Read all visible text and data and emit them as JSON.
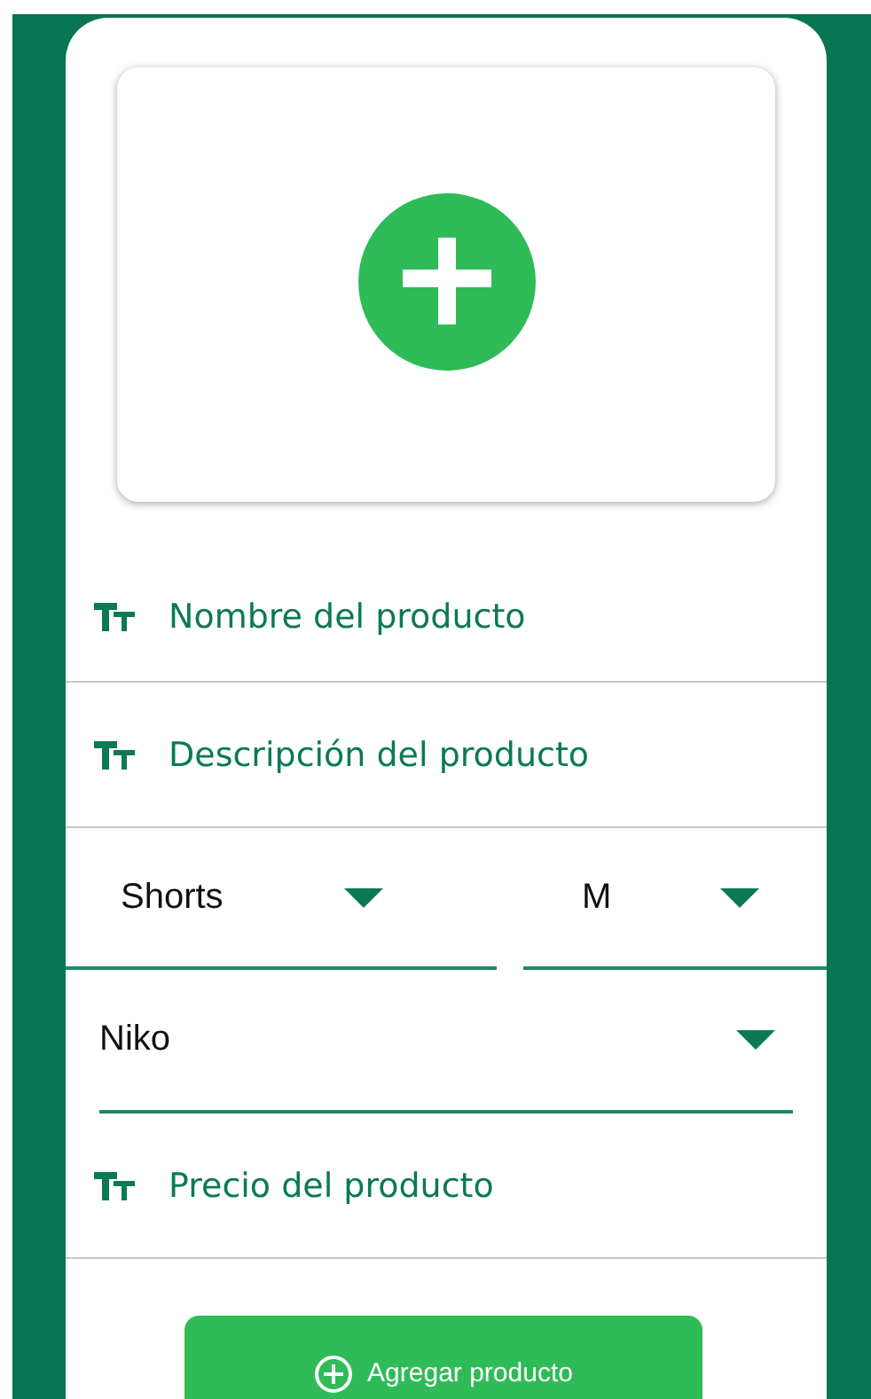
{
  "fields": [
    {
      "kind": "text",
      "placeholder": "Nombre del producto"
    },
    {
      "kind": "text",
      "placeholder": "Descripción del producto"
    },
    {
      "kind": "select_row",
      "selects": [
        {
          "value": "Shorts"
        },
        {
          "value": "M"
        }
      ]
    },
    {
      "kind": "select",
      "value": "Niko"
    },
    {
      "kind": "text",
      "placeholder": "Precio del producto"
    }
  ],
  "button": {
    "label": "Agregar producto"
  }
}
